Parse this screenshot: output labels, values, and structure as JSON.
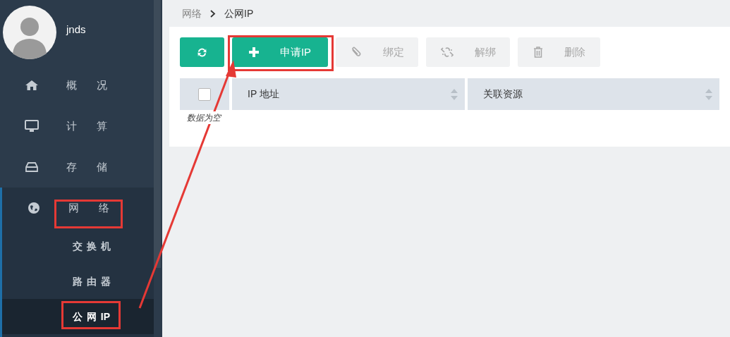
{
  "user": {
    "name": "jnds"
  },
  "menu": [
    {
      "label": "概 况",
      "expanded": false
    },
    {
      "label": "计 算",
      "expanded": false
    },
    {
      "label": "存 储",
      "expanded": false
    },
    {
      "label": "网 络",
      "expanded": true,
      "children": [
        {
          "label": "交 换 机",
          "selected": false
        },
        {
          "label": "路 由 器",
          "selected": false
        },
        {
          "label": "公 网 IP",
          "selected": true
        }
      ]
    }
  ],
  "breadcrumb": [
    "网络",
    "公网IP"
  ],
  "toolbar": [
    {
      "kind": "refresh",
      "disabled": false
    },
    {
      "kind": "add",
      "label": "申请IP",
      "disabled": false
    },
    {
      "kind": "bind",
      "label": "绑定",
      "disabled": true
    },
    {
      "kind": "unbind",
      "label": "解绑",
      "disabled": true
    },
    {
      "kind": "delete",
      "label": "删除",
      "disabled": true
    }
  ],
  "table": {
    "select_all": {
      "checked": false
    },
    "columns": [
      {
        "label": "IP 地址",
        "sortable": true
      },
      {
        "label": "关联资源",
        "sortable": true
      }
    ],
    "empty_text": "数据为空"
  }
}
